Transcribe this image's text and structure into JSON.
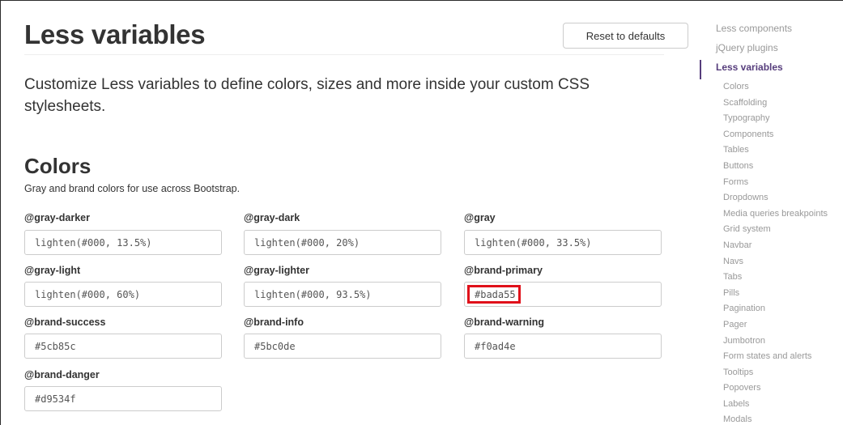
{
  "header": {
    "title": "Less variables",
    "reset_label": "Reset to defaults"
  },
  "lead": "Customize Less variables to define colors, sizes and more inside your custom CSS stylesheets.",
  "colors_section": {
    "title": "Colors",
    "description": "Gray and brand colors for use across Bootstrap.",
    "variables": [
      {
        "name": "@gray-darker",
        "value": "lighten(#000, 13.5%)"
      },
      {
        "name": "@gray-dark",
        "value": "lighten(#000, 20%)"
      },
      {
        "name": "@gray",
        "value": "lighten(#000, 33.5%)"
      },
      {
        "name": "@gray-light",
        "value": "lighten(#000, 60%)"
      },
      {
        "name": "@gray-lighter",
        "value": "lighten(#000, 93.5%)"
      },
      {
        "name": "@brand-primary",
        "value": "#bada55"
      },
      {
        "name": "@brand-success",
        "value": "#5cb85c"
      },
      {
        "name": "@brand-info",
        "value": "#5bc0de"
      },
      {
        "name": "@brand-warning",
        "value": "#f0ad4e"
      },
      {
        "name": "@brand-danger",
        "value": "#d9534f"
      }
    ],
    "highlight_color": "#e0101a"
  },
  "sidebar": {
    "top_items": [
      {
        "label": "Less components",
        "active": false
      },
      {
        "label": "jQuery plugins",
        "active": false
      },
      {
        "label": "Less variables",
        "active": true
      }
    ],
    "sub_items": [
      "Colors",
      "Scaffolding",
      "Typography",
      "Components",
      "Tables",
      "Buttons",
      "Forms",
      "Dropdowns",
      "Media queries breakpoints",
      "Grid system",
      "Navbar",
      "Navs",
      "Tabs",
      "Pills",
      "Pagination",
      "Pager",
      "Jumbotron",
      "Form states and alerts",
      "Tooltips",
      "Popovers",
      "Labels",
      "Modals"
    ],
    "accent_color": "#563d7c"
  }
}
